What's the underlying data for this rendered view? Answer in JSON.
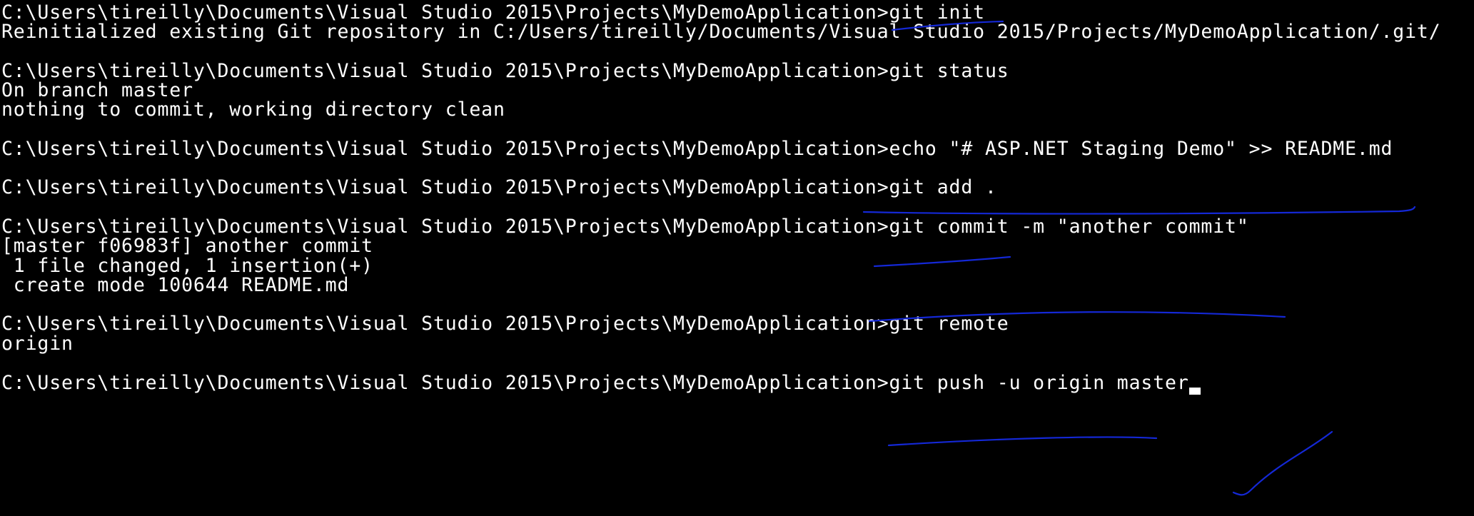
{
  "terminal": {
    "lines": [
      "C:\\Users\\tireilly\\Documents\\Visual Studio 2015\\Projects\\MyDemoApplication>git init",
      "Reinitialized existing Git repository in C:/Users/tireilly/Documents/Visual Studio 2015/Projects/MyDemoApplication/.git/",
      "",
      "C:\\Users\\tireilly\\Documents\\Visual Studio 2015\\Projects\\MyDemoApplication>git status",
      "On branch master",
      "nothing to commit, working directory clean",
      "",
      "C:\\Users\\tireilly\\Documents\\Visual Studio 2015\\Projects\\MyDemoApplication>echo \"# ASP.NET Staging Demo\" >> README.md",
      "",
      "C:\\Users\\tireilly\\Documents\\Visual Studio 2015\\Projects\\MyDemoApplication>git add .",
      "",
      "C:\\Users\\tireilly\\Documents\\Visual Studio 2015\\Projects\\MyDemoApplication>git commit -m \"another commit\"",
      "[master f06983f] another commit",
      " 1 file changed, 1 insertion(+)",
      " create mode 100644 README.md",
      "",
      "C:\\Users\\tireilly\\Documents\\Visual Studio 2015\\Projects\\MyDemoApplication>git remote",
      "origin",
      "",
      "C:\\Users\\tireilly\\Documents\\Visual Studio 2015\\Projects\\MyDemoApplication>git push -u origin master"
    ]
  },
  "colors": {
    "background": "#000000",
    "text": "#ffffff",
    "annotation_ink": "#1428d6"
  }
}
